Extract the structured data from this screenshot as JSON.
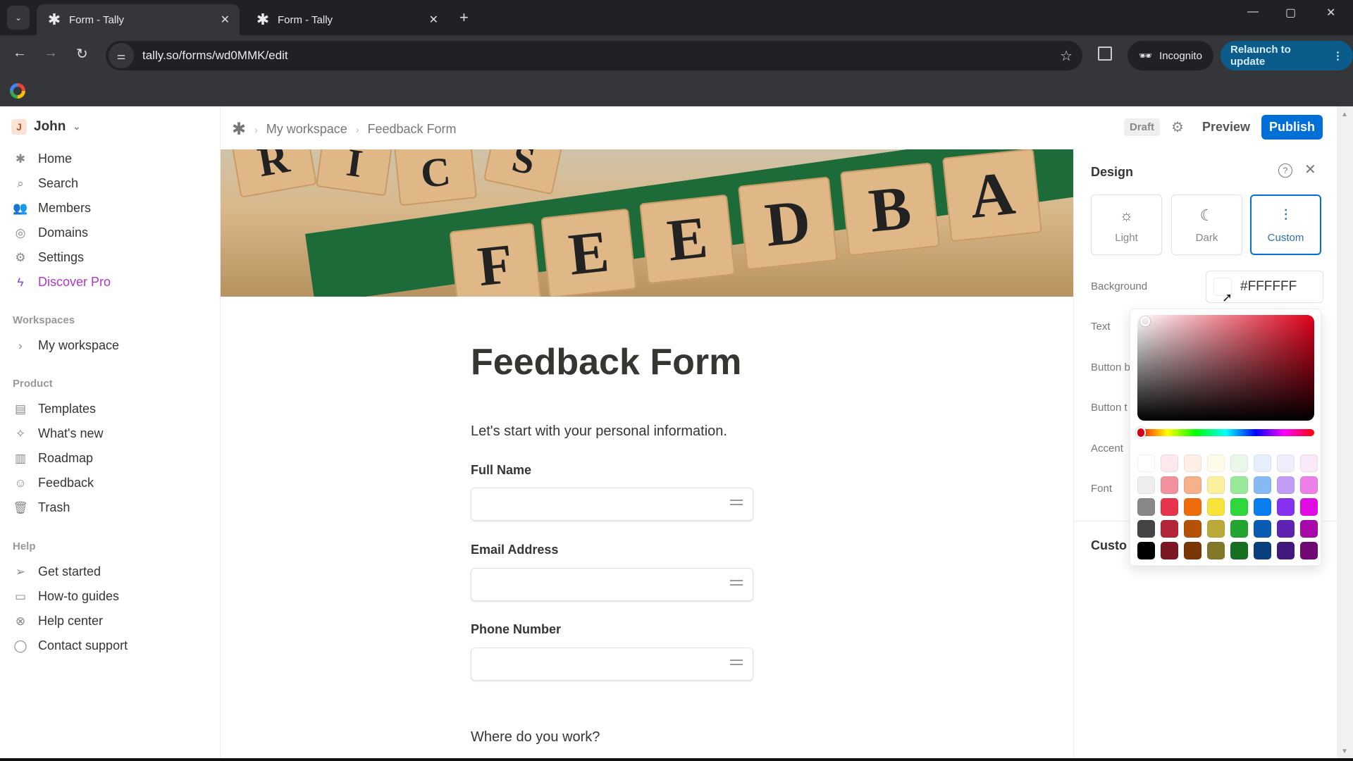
{
  "browser": {
    "tabs": [
      {
        "title": "Form - Tally",
        "active": true
      },
      {
        "title": "Form - Tally",
        "active": false
      }
    ],
    "url": "tally.so/forms/wd0MMK/edit",
    "incognito_label": "Incognito",
    "relaunch_label": "Relaunch to update",
    "icons": {
      "tab_favicon": "✱",
      "close": "✕",
      "new_tab": "+",
      "back": "←",
      "forward": "→",
      "reload": "↻",
      "star": "☆",
      "minimize": "—",
      "maximize": "▢",
      "window_close": "✕",
      "more": "⋮",
      "tab_menu": "⌄"
    }
  },
  "sidebar": {
    "user": {
      "initial": "J",
      "name": "John"
    },
    "nav": [
      {
        "label": "Home",
        "icon": "✱"
      },
      {
        "label": "Search",
        "icon": "⌕"
      },
      {
        "label": "Members",
        "icon": "👥"
      },
      {
        "label": "Domains",
        "icon": "◎"
      },
      {
        "label": "Settings",
        "icon": "⚙"
      },
      {
        "label": "Discover Pro",
        "icon": "ϟ"
      }
    ],
    "workspaces_heading": "Workspaces",
    "workspaces": [
      {
        "label": "My workspace",
        "icon": "›"
      }
    ],
    "product_heading": "Product",
    "product": [
      {
        "label": "Templates",
        "icon": "▤"
      },
      {
        "label": "What's new",
        "icon": "✧"
      },
      {
        "label": "Roadmap",
        "icon": "▥"
      },
      {
        "label": "Feedback",
        "icon": "☺"
      },
      {
        "label": "Trash",
        "icon": "🗑"
      }
    ],
    "help_heading": "Help",
    "help": [
      {
        "label": "Get started",
        "icon": "➢"
      },
      {
        "label": "How-to guides",
        "icon": "▭"
      },
      {
        "label": "Help center",
        "icon": "⊗"
      },
      {
        "label": "Contact support",
        "icon": "◯"
      }
    ]
  },
  "header": {
    "breadcrumb": [
      "My workspace",
      "Feedback Form"
    ],
    "status": "Draft",
    "preview_label": "Preview",
    "publish_label": "Publish"
  },
  "banner": {
    "tiles": [
      "R",
      "I",
      "C",
      "S",
      "F",
      "E",
      "E",
      "D",
      "B",
      "A"
    ]
  },
  "form": {
    "title": "Feedback Form",
    "description": "Let's start with your personal information.",
    "fields": [
      {
        "label": "Full Name",
        "value": ""
      },
      {
        "label": "Email Address",
        "value": ""
      },
      {
        "label": "Phone Number",
        "value": ""
      }
    ],
    "next_question": "Where do you work?"
  },
  "design_panel": {
    "title": "Design",
    "themes": [
      {
        "label": "Light",
        "icon": "☼",
        "selected": false
      },
      {
        "label": "Dark",
        "icon": "☾",
        "selected": false
      },
      {
        "label": "Custom",
        "icon": "⫶",
        "selected": true
      }
    ],
    "rows": [
      {
        "label": "Background",
        "value": "#FFFFFF"
      },
      {
        "label": "Text"
      },
      {
        "label": "Button b"
      },
      {
        "label": "Button t"
      },
      {
        "label": "Accent"
      },
      {
        "label": "Font"
      }
    ],
    "custom_heading": "Custo",
    "picker": {
      "hue_color": "#e0001a",
      "swatches": [
        [
          "#ffffff",
          "#fde8ec",
          "#fdeee6",
          "#fefbe8",
          "#eaf8ec",
          "#e6f0fd",
          "#efeefd",
          "#fbe8f9"
        ],
        [
          "#eeeeee",
          "#f4919f",
          "#f7b18a",
          "#fcef9d",
          "#98ea98",
          "#86b9f6",
          "#c29df6",
          "#ec7fe8"
        ],
        [
          "#888888",
          "#e8344a",
          "#ef6c0c",
          "#f7e23c",
          "#2ed83c",
          "#0a7ef0",
          "#8631f0",
          "#e10ce3"
        ],
        [
          "#444444",
          "#b3263a",
          "#b45208",
          "#bba93a",
          "#21a52e",
          "#0a5bb4",
          "#5f23b2",
          "#a70aa8"
        ],
        [
          "#000000",
          "#7b1824",
          "#7a3705",
          "#82782a",
          "#177021",
          "#07407c",
          "#41197c",
          "#720872"
        ]
      ]
    }
  }
}
